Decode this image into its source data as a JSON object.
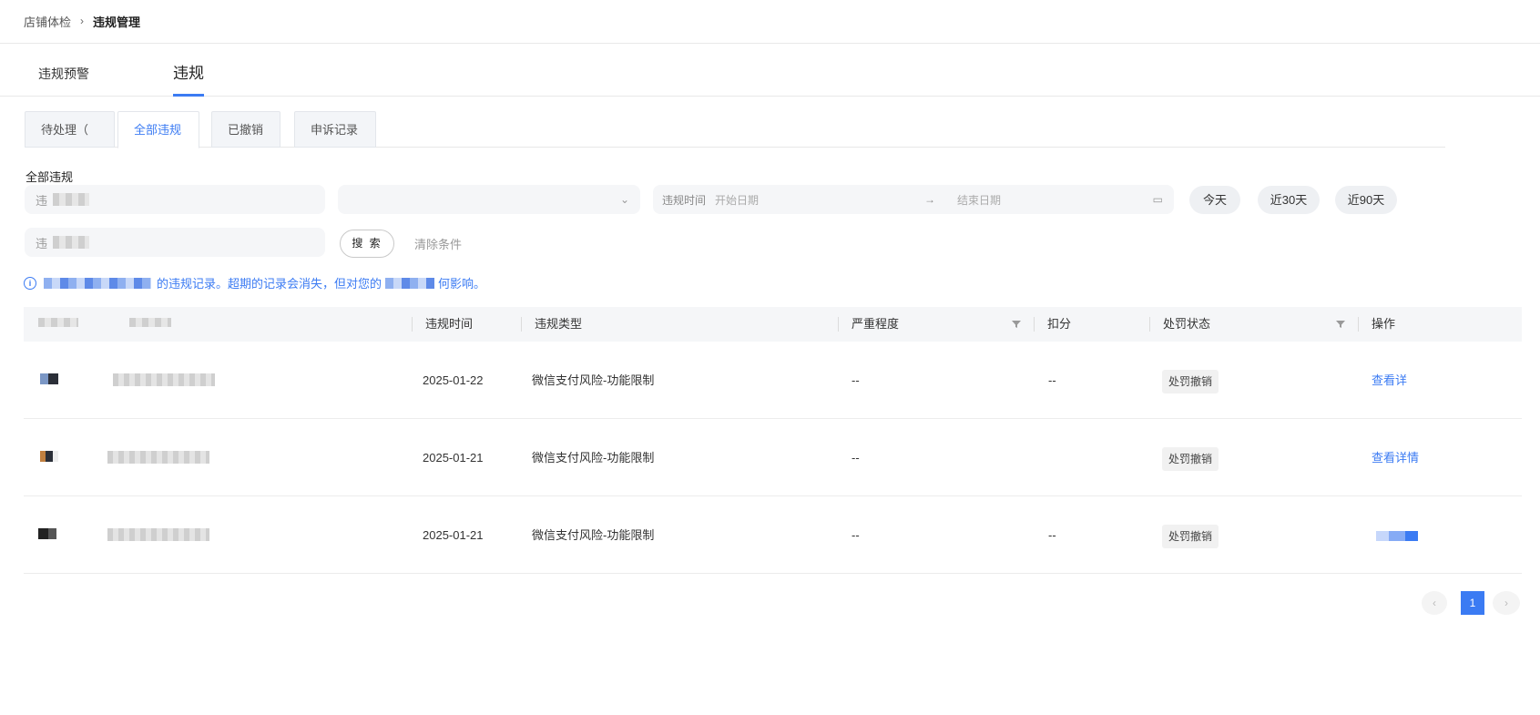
{
  "breadcrumb": {
    "home": "店铺体检",
    "separator": "›",
    "current": "违规管理"
  },
  "main_tabs": [
    {
      "label": "违规预警"
    },
    {
      "label": "违规"
    }
  ],
  "sub_tabs": [
    {
      "label": "待处理（"
    },
    {
      "label": "全部违规"
    },
    {
      "label": "已撤销"
    },
    {
      "label": "申诉记录"
    }
  ],
  "filters": {
    "section_label": "全部违规",
    "input1_placeholder": "违",
    "input3_placeholder": "违",
    "select_chevron": "⌄",
    "date_label": "违规时间",
    "date_start_placeholder": "开始日期",
    "date_arrow": "→",
    "date_end_placeholder": "结束日期",
    "calendar_icon": "▭",
    "quick": [
      "今天",
      "近30天",
      "近90天"
    ],
    "search_label": "搜 索",
    "clear_label": "清除条件"
  },
  "notice": {
    "icon": "i",
    "text_mid": "的违规记录。超期的记录会消失，但对您的",
    "text_end": "何影响。"
  },
  "table": {
    "columns": [
      "违规时间",
      "违规类型",
      "严重程度",
      "扣分",
      "处罚状态",
      "操作"
    ],
    "rows": [
      {
        "time": "2025-01-22",
        "type": "微信支付风险-功能限制",
        "severity": "--",
        "points": "--",
        "status": "处罚撤销",
        "action": "查看详"
      },
      {
        "time": "2025-01-21",
        "type": "微信支付风险-功能限制",
        "severity": "--",
        "points": "",
        "status": "处罚撤销",
        "action": "查看详情"
      },
      {
        "time": "2025-01-21",
        "type": "微信支付风险-功能限制",
        "severity": "--",
        "points": "--",
        "status": "处罚撤销",
        "action": ""
      }
    ]
  },
  "pagination": {
    "prev": "‹",
    "current": "1",
    "next": "›"
  },
  "colors": {
    "accent": "#3b7bf3",
    "tag_bg": "#f1f1f1",
    "header_bg": "#f5f6f8"
  }
}
